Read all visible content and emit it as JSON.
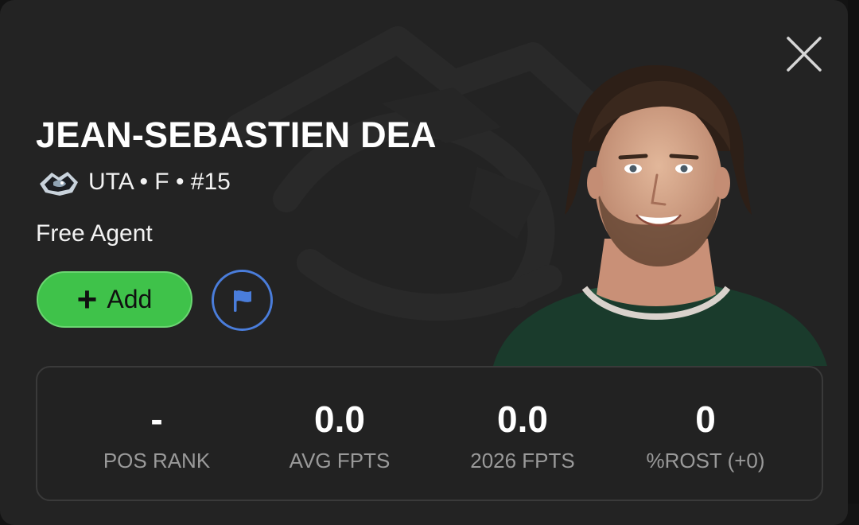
{
  "player": {
    "name": "JEAN-SEBASTIEN DEA",
    "team_info": "UTA • F • #15",
    "status": "Free Agent"
  },
  "actions": {
    "add_label": "Add",
    "add_icon": "plus-icon",
    "flag_icon": "flag-icon",
    "close_icon": "close-icon"
  },
  "stats": [
    {
      "value": "-",
      "label": "POS RANK"
    },
    {
      "value": "0.0",
      "label": "AVG FPTS"
    },
    {
      "value": "0.0",
      "label": "2026 FPTS"
    },
    {
      "value": "0",
      "label": "%ROST (+0)"
    }
  ],
  "colors": {
    "card_bg": "#232323",
    "add_green": "#3fc24a",
    "flag_blue": "#4a7ddb",
    "label_gray": "#9a9a9a"
  }
}
